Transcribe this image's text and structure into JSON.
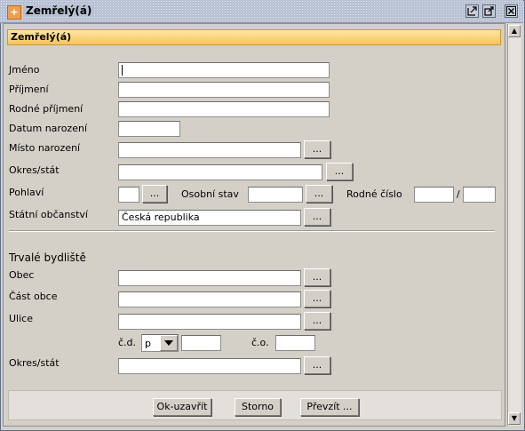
{
  "window": {
    "title": "Zemřelý(á)",
    "app_icon": "plus-icon",
    "controls": [
      "restore-icon",
      "maximize-icon",
      "close-icon"
    ]
  },
  "header": {
    "title": "Zemřelý(á)"
  },
  "person": {
    "jmeno_label": "Jméno",
    "prijmeni_label": "Příjmení",
    "rodne_prijmeni_label": "Rodné příjmení",
    "datum_narozeni_label": "Datum narození",
    "misto_narozeni_label": "Místo narození",
    "okres_stat_label": "Okres/stát",
    "pohlavi_label": "Pohlaví",
    "osobni_stav_label": "Osobní stav",
    "rodne_cislo_label": "Rodné číslo",
    "rodne_cislo_separator": "/",
    "statni_obcanstvi_label": "Státní občanství",
    "statni_obcanstvi_value": "Česká republika"
  },
  "address": {
    "section_title": "Trvalé bydliště",
    "obec_label": "Obec",
    "cast_obce_label": "Část obce",
    "ulice_label": "Ulice",
    "cd_label": "č.d.",
    "cd_type_value": "p",
    "co_label": "č.o.",
    "okres_stat_label": "Okres/stát"
  },
  "lookup_button_label": "...",
  "footer": {
    "ok_label": "Ok-uzavřít",
    "storno_label": "Storno",
    "prevzit_label": "Převzít ..."
  },
  "colors": {
    "titlebar": "#b7c1d3",
    "header_bar": "#f8c35a",
    "background": "#d4d0c8"
  }
}
